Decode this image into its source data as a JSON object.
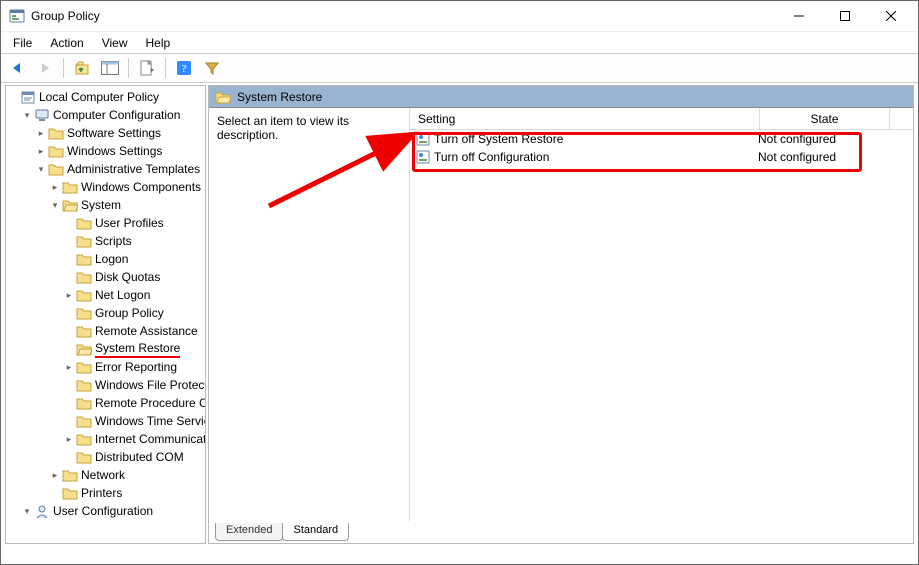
{
  "window": {
    "title": "Group Policy"
  },
  "menu": {
    "file": "File",
    "action": "Action",
    "view": "View",
    "help": "Help"
  },
  "tree": {
    "root": "Local Computer Policy",
    "comp_cfg": "Computer Configuration",
    "software": "Software Settings",
    "windows_settings": "Windows Settings",
    "admin_templates": "Administrative Templates",
    "win_components": "Windows Components",
    "system": "System",
    "user_profiles": "User Profiles",
    "scripts": "Scripts",
    "logon": "Logon",
    "disk_quotas": "Disk Quotas",
    "net_logon": "Net Logon",
    "group_policy": "Group Policy",
    "remote_assist": "Remote Assistance",
    "system_restore": "System Restore",
    "error_reporting": "Error Reporting",
    "windows_file": "Windows File Protection",
    "remote_proc": "Remote Procedure Call",
    "windows_time": "Windows Time Service",
    "internet_comm": "Internet Communication Management",
    "distributed_com": "Distributed COM",
    "network": "Network",
    "printers": "Printers",
    "user_cfg": "User Configuration"
  },
  "content": {
    "header_title": "System Restore",
    "desc_prompt": "Select an item to view its description.",
    "columns": {
      "setting": "Setting",
      "state": "State"
    },
    "rows": [
      {
        "setting": "Turn off System Restore",
        "state": "Not configured"
      },
      {
        "setting": "Turn off Configuration",
        "state": "Not configured"
      }
    ],
    "tabs": {
      "extended": "Extended",
      "standard": "Standard"
    }
  }
}
